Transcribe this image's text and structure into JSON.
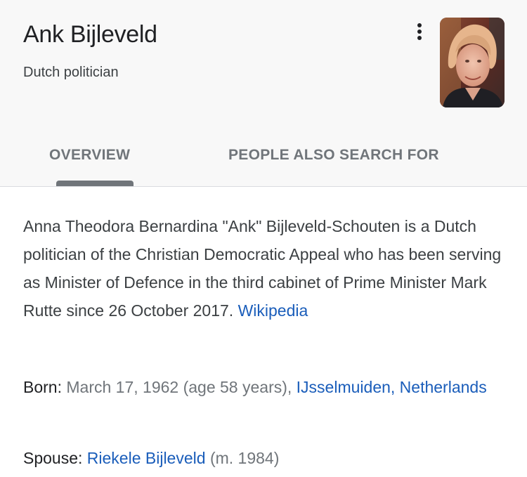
{
  "header": {
    "title": "Ank Bijleveld",
    "subtitle": "Dutch politician",
    "more_icon": "more-vertical-icon",
    "image_alt": "Ank Bijleveld photo"
  },
  "tabs": [
    {
      "label": "OVERVIEW",
      "selected": true
    },
    {
      "label": "PEOPLE ALSO SEARCH FOR",
      "selected": false
    }
  ],
  "description": {
    "text": "Anna Theodora Bernardina \"Ank\" Bijleveld-Schouten is a Dutch politician of the Christian Democratic Appeal who has been serving as Minister of Defence in the third cabinet of Prime Minister Mark Rutte since 26 October 2017.",
    "source_link": "Wikipedia"
  },
  "facts": {
    "born": {
      "label": "Born:",
      "value": "March 17, 1962 (age 58 years),",
      "place_link": "IJsselmuiden, Netherlands"
    },
    "spouse": {
      "label": "Spouse:",
      "name_link": "Riekele Bijleveld",
      "detail": "(m. 1984)"
    }
  },
  "colors": {
    "header_bg": "#f8f8f8",
    "link": "#1a5dba",
    "muted": "#70757a",
    "text": "#202124"
  }
}
